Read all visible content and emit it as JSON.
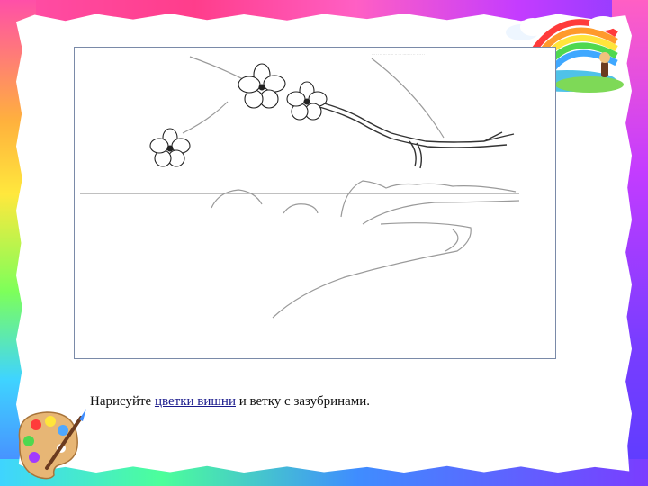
{
  "caption": {
    "before": "Нарисуйте ",
    "link": "цветки вишни",
    "after": " и ветку с зазубринами."
  },
  "sketch": {
    "header_fine_print": "··· ·· ·· ··· ····· ·· ··· ····· ·· ·· ···· ··"
  },
  "icons": [
    "rainbow-landscape-icon",
    "paint-palette-icon",
    "cherry-blossom-icon"
  ],
  "colors": {
    "link": "#1a1a8c",
    "sketch_line": "#9a9a9a",
    "frame_border": "#7a8aa8"
  }
}
